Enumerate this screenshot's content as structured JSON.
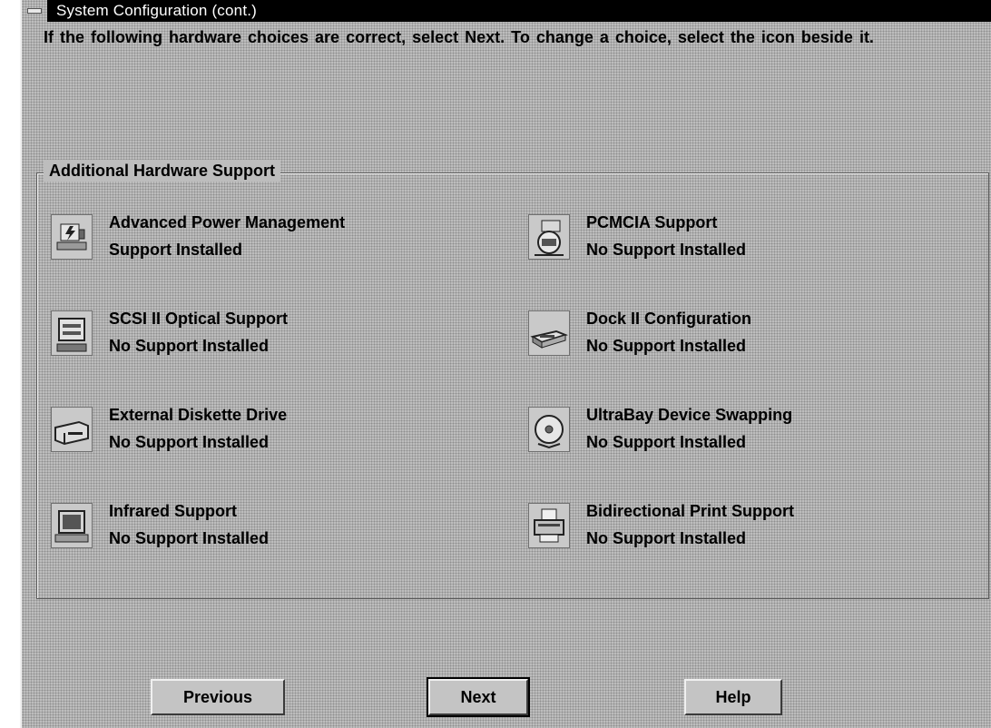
{
  "window": {
    "title": "System Configuration (cont.)"
  },
  "instruction": "If the following hardware choices are correct, select Next.  To change a choice, select the icon beside it.",
  "group": {
    "title": "Additional Hardware Support",
    "items": [
      {
        "name": "Advanced Power Management",
        "status": "Support Installed",
        "icon": "power-management-icon"
      },
      {
        "name": "PCMCIA Support",
        "status": "No Support Installed",
        "icon": "pcmcia-card-icon"
      },
      {
        "name": "SCSI II Optical Support",
        "status": "No Support Installed",
        "icon": "optical-drive-icon"
      },
      {
        "name": "Dock II Configuration",
        "status": "No Support Installed",
        "icon": "dock-icon"
      },
      {
        "name": "External Diskette Drive",
        "status": "No Support Installed",
        "icon": "diskette-drive-icon"
      },
      {
        "name": "UltraBay Device Swapping",
        "status": "No Support Installed",
        "icon": "cd-swap-icon"
      },
      {
        "name": "Infrared Support",
        "status": "No Support Installed",
        "icon": "infrared-icon"
      },
      {
        "name": "Bidirectional Print Support",
        "status": "No Support Installed",
        "icon": "printer-icon"
      }
    ]
  },
  "buttons": {
    "previous": "Previous",
    "next": "Next",
    "help": "Help"
  }
}
